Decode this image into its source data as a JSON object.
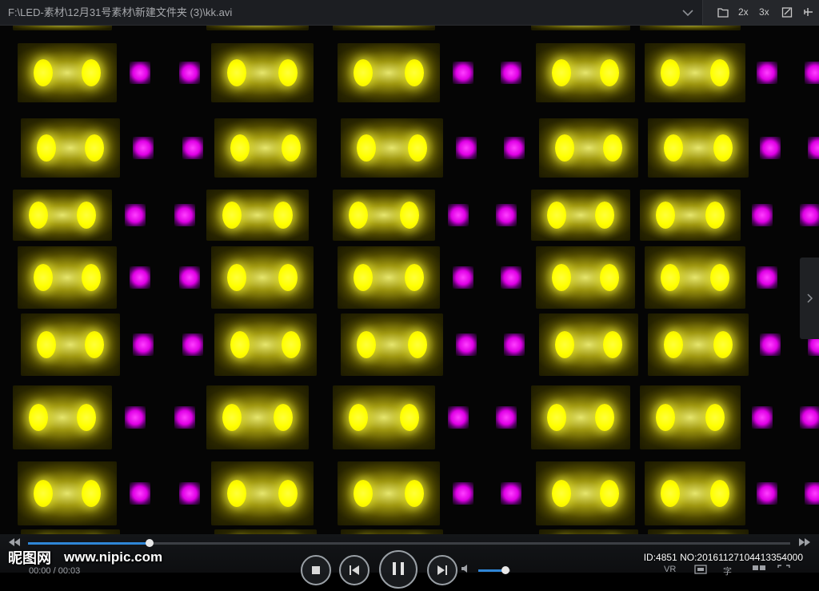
{
  "window": {
    "title_path": "F:\\LED-素材\\12月31号素材\\新建文件夹 (3)\\kk.avi",
    "toolbar": {
      "open_folder_icon": "folder-icon",
      "zoom_2x_label": "2x",
      "zoom_3x_label": "3x",
      "exit_icon": "exit-window-icon",
      "pin_icon": "pin-icon"
    }
  },
  "video": {
    "content": "yellow-and-magenta-led-grid",
    "colors": {
      "yellow": "#ffff00",
      "magenta": "#e000e6",
      "background": "#000000"
    }
  },
  "side_panel": {
    "expand_icon": "chevron-right-icon"
  },
  "playback": {
    "time_label": "00:00 / 00:03",
    "progress_fraction": 0.16,
    "volume_fraction": 0.85,
    "accent_color": "#2f86d6"
  },
  "controls": {
    "stop_icon": "stop-icon",
    "previous_icon": "previous-icon",
    "pause_icon": "pause-icon",
    "next_icon": "next-icon",
    "volume_icon": "volume-icon",
    "vr_label": "VR",
    "subtitle_label": "字"
  },
  "watermark": {
    "logo_text": "昵图网",
    "url": "www.nipic.com",
    "id_text": "ID:4851 NO:20161127104413354000"
  }
}
